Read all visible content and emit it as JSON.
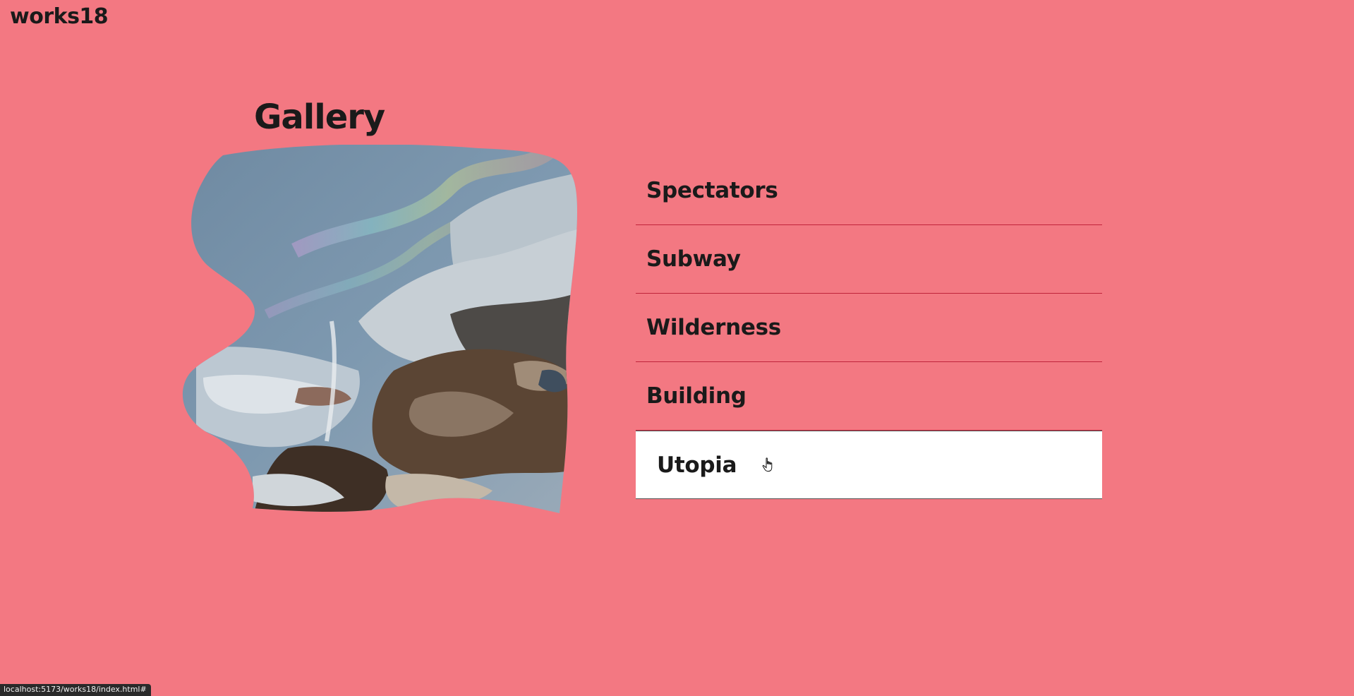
{
  "header": {
    "site_title": "works18"
  },
  "gallery": {
    "title": "Gallery",
    "image_icon": "liquid-distorted-photo"
  },
  "menu": {
    "items": [
      {
        "label": "Spectators",
        "active": false
      },
      {
        "label": "Subway",
        "active": false
      },
      {
        "label": "Wilderness",
        "active": false
      },
      {
        "label": "Building",
        "active": false
      },
      {
        "label": "Utopia",
        "active": true
      }
    ]
  },
  "status_bar": {
    "url": "localhost:5173/works18/index.html#"
  },
  "colors": {
    "background": "#f37882",
    "divider": "#c0243a",
    "active_bg": "#ffffff",
    "text": "#1a1a1a"
  }
}
